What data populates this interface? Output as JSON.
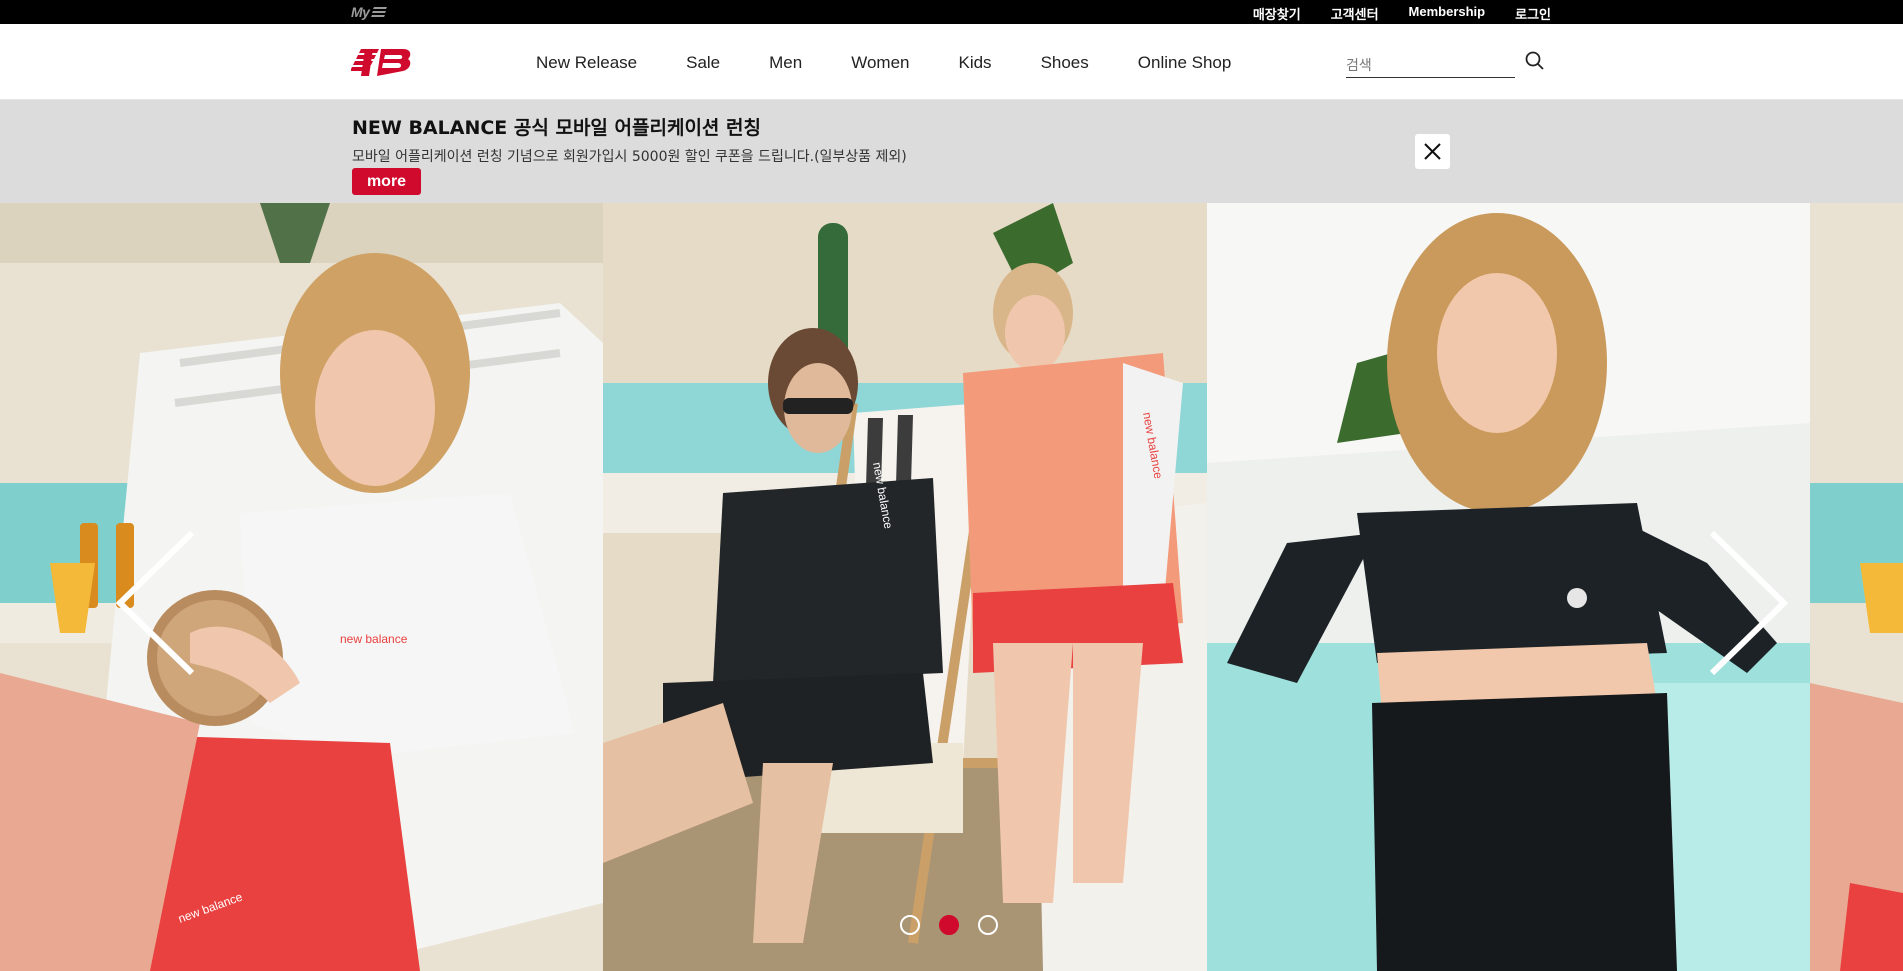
{
  "utility_bar": {
    "logo_text": "My NB",
    "links": [
      "매장찾기",
      "고객센터",
      "Membership",
      "로그인"
    ]
  },
  "header": {
    "nav": [
      "New Release",
      "Sale",
      "Men",
      "Women",
      "Kids",
      "Shoes",
      "Online Shop"
    ],
    "search": {
      "placeholder": "검색",
      "value": ""
    },
    "brand_color": "#cf0a2c"
  },
  "promo": {
    "title": "NEW BALANCE 공식 모바일 어플리케이션 런칭",
    "description": "모바일 어플리케이션 런칭 기념으로 회원가입시 5000원 할인 쿠폰을 드립니다.(일부상품 제외)",
    "more_label": "more",
    "close_icon": "close-icon"
  },
  "carousel": {
    "slides": [
      {
        "subject": "woman in white rash guard holding coconut, red shorts"
      },
      {
        "subject": "man in black rash guard on deck chair, woman in coral rash guard"
      },
      {
        "subject": "woman in black crop rash guard and leggings by pool"
      }
    ],
    "dot_count": 3,
    "active_dot": 2,
    "prev_icon": "chevron-left-icon",
    "next_icon": "chevron-right-icon"
  }
}
